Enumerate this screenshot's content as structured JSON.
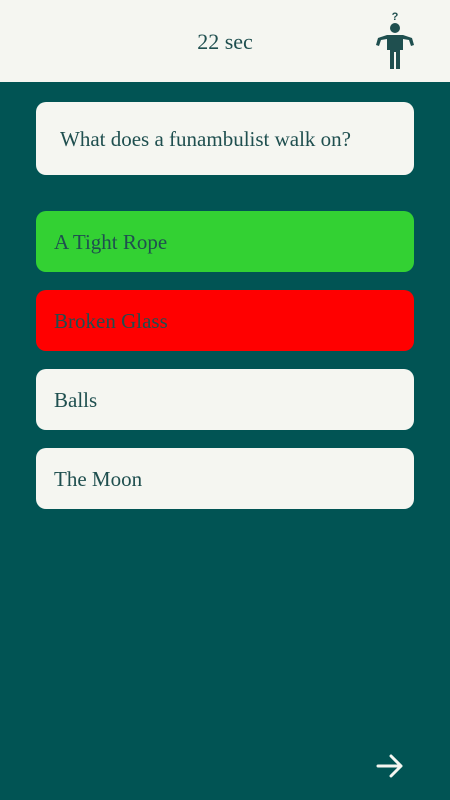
{
  "header": {
    "timer_text": "22 sec",
    "help_icon": "person-question-icon",
    "help_icon_glyph": "?"
  },
  "question": {
    "text": "What does a funambulist walk on?"
  },
  "answers": [
    {
      "label": "A Tight Rope",
      "state": "correct",
      "color": "#33d133"
    },
    {
      "label": "Broken Glass",
      "state": "wrong",
      "color": "#ff0000"
    },
    {
      "label": "Balls",
      "state": "neutral",
      "color": "#f5f6f1"
    },
    {
      "label": "The Moon",
      "state": "neutral",
      "color": "#f5f6f1"
    }
  ],
  "footer": {
    "next_icon": "arrow-right-icon"
  },
  "colors": {
    "background": "#015454",
    "surface": "#f5f6f1",
    "text": "#1f4f4f",
    "correct": "#33d133",
    "wrong": "#ff0000"
  }
}
